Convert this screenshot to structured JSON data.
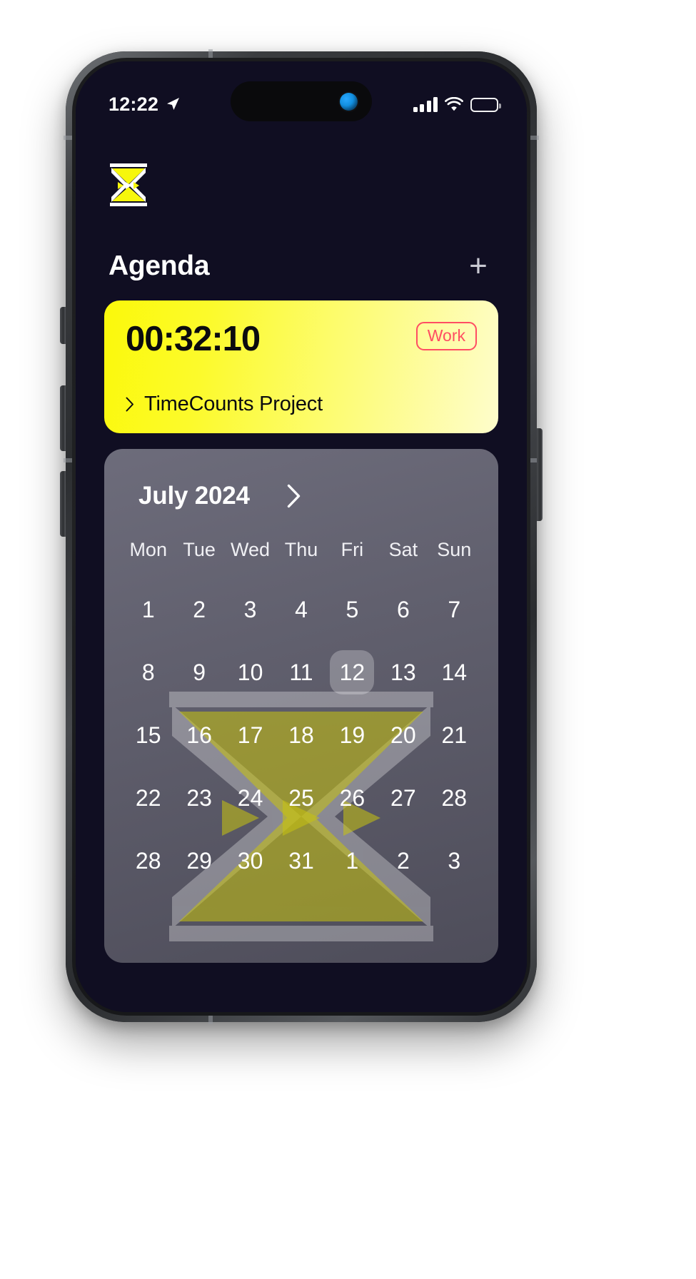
{
  "status_bar": {
    "time": "12:22",
    "location_icon": "location-arrow-icon",
    "signal_icon": "cellular-signal-icon",
    "wifi_icon": "wifi-icon",
    "battery_icon": "battery-full-icon"
  },
  "app": {
    "logo_icon": "hourglass-logo-icon",
    "title": "Agenda",
    "add_label": "+"
  },
  "timer_card": {
    "elapsed": "00:32:10",
    "tag": "Work",
    "project": "TimeCounts Project",
    "chevron_icon": "chevron-right-icon",
    "bg_color_start": "#FBF90A",
    "bg_color_end": "#FEFDCC",
    "tag_color": "#FF4D63",
    "text_color": "#0B0B0F"
  },
  "calendar": {
    "month": "July 2024",
    "next_icon": "chevron-right-icon",
    "weekdays": [
      "Mon",
      "Tue",
      "Wed",
      "Thu",
      "Fri",
      "Sat",
      "Sun"
    ],
    "selected_day": "12",
    "watermark_icon": "hourglass-watermark-icon",
    "card_color": "#605F6D",
    "weeks": [
      [
        "1",
        "2",
        "3",
        "4",
        "5",
        "6",
        "7"
      ],
      [
        "8",
        "9",
        "10",
        "11",
        "12",
        "13",
        "14"
      ],
      [
        "15",
        "16",
        "17",
        "18",
        "19",
        "20",
        "21"
      ],
      [
        "22",
        "23",
        "24",
        "25",
        "26",
        "27",
        "28"
      ],
      [
        "28",
        "29",
        "30",
        "31",
        "1",
        "2",
        "3"
      ]
    ]
  }
}
